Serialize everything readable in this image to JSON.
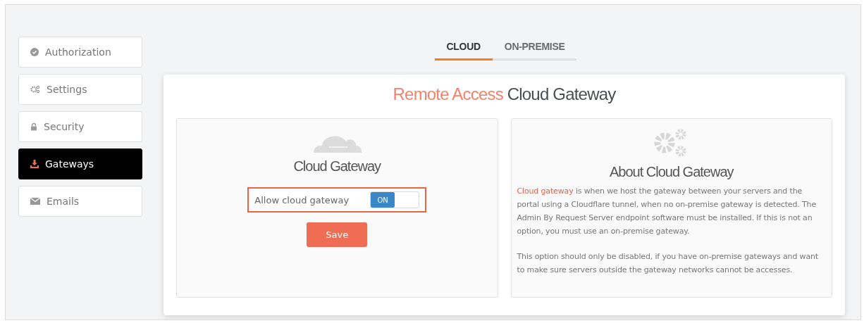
{
  "sidebar": {
    "items": [
      {
        "label": "Authorization",
        "selected": false
      },
      {
        "label": "Settings",
        "selected": false
      },
      {
        "label": "Security",
        "selected": false
      },
      {
        "label": "Gateways",
        "selected": true
      },
      {
        "label": "Emails",
        "selected": false
      }
    ]
  },
  "tabs": [
    {
      "label": "CLOUD",
      "selected": true
    },
    {
      "label": "ON-PREMISE",
      "selected": false
    }
  ],
  "card": {
    "title_accent": "Remote Access",
    "title_rest": "Cloud Gateway",
    "left_panel": {
      "heading": "Cloud Gateway",
      "toggle": {
        "label": "Allow cloud gateway",
        "on": true,
        "state_text": "ON",
        "highlighted": true
      },
      "save_button": "Save"
    },
    "right_panel": {
      "heading": "About Cloud Gateway",
      "paragraphs": [
        {
          "link": "Cloud gateway",
          "text": " is when we host the gateway between your servers and the portal using a Cloudflare tunnel, when no on-premise gateway is detected. The Admin By Request Server endpoint software must be installed. If this is not an option, you must use an on-premise gateway."
        },
        {
          "text": "This option should only be disabled, if you have on-premise gateways and want to make sure servers outside the gateway networks cannot be accesses."
        }
      ]
    }
  }
}
